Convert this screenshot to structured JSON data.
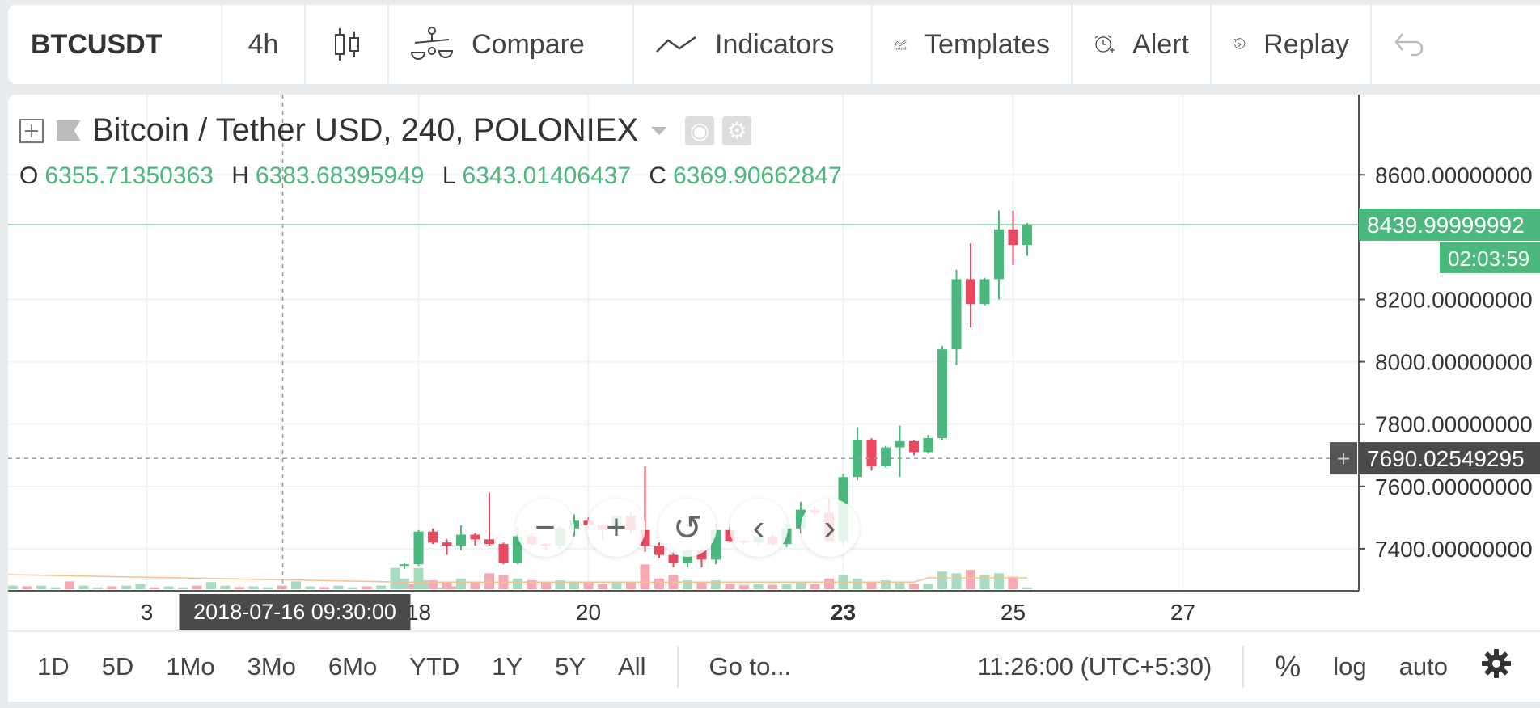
{
  "toolbar": {
    "symbol": "BTCUSDT",
    "interval": "4h",
    "compare_label": "Compare",
    "indicators_label": "Indicators",
    "templates_label": "Templates",
    "alert_label": "Alert",
    "replay_label": "Replay"
  },
  "legend": {
    "title": "Bitcoin / Tether USD, 240, POLONIEX",
    "o_label": "O",
    "o": "6355.71350363",
    "h_label": "H",
    "h": "6383.68395949",
    "l_label": "L",
    "l": "6343.01406437",
    "c_label": "C",
    "c": "6369.90662847"
  },
  "colors": {
    "up": "#4bb87d",
    "down": "#e8495e",
    "up_vol": "#a8dcc0",
    "down_vol": "#f4a9b3"
  },
  "chart_data": {
    "type": "candlestick",
    "y_ticks": [
      {
        "label": "8600.00000000",
        "value": 8600
      },
      {
        "label": "8200.00000000",
        "value": 8200
      },
      {
        "label": "8000.00000000",
        "value": 8000
      },
      {
        "label": "7800.00000000",
        "value": 7800
      },
      {
        "label": "7600.00000000",
        "value": 7600
      },
      {
        "label": "7400.00000000",
        "value": 7400
      }
    ],
    "ylim": [
      7270,
      8650
    ],
    "x_ticks": [
      {
        "label": "3",
        "index": -18.2
      },
      {
        "label": "18",
        "index": 1
      },
      {
        "label": "20",
        "index": 13
      },
      {
        "label": "23",
        "index": 31,
        "bold": true
      },
      {
        "label": "25",
        "index": 43
      },
      {
        "label": "27",
        "index": 55
      }
    ],
    "last_price": {
      "label": "8439.99999992",
      "value": 8440,
      "countdown": "02:03:59"
    },
    "crosshair": {
      "price_label": "7690.02549295",
      "value": 7690,
      "time_label": "2018-07-16 09:30:00",
      "index": -8.6
    },
    "candles": [
      [
        7345,
        7355,
        7335,
        7350,
        30
      ],
      [
        7350,
        7460,
        7345,
        7455,
        60
      ],
      [
        7455,
        7465,
        7415,
        7420,
        25
      ],
      [
        7420,
        7430,
        7380,
        7410,
        20
      ],
      [
        7410,
        7475,
        7395,
        7445,
        30
      ],
      [
        7445,
        7450,
        7410,
        7430,
        20
      ],
      [
        7430,
        7580,
        7410,
        7415,
        45
      ],
      [
        7415,
        7420,
        7350,
        7355,
        40
      ],
      [
        7355,
        7470,
        7350,
        7440,
        30
      ],
      [
        7440,
        7450,
        7410,
        7415,
        25
      ],
      [
        7415,
        7420,
        7395,
        7410,
        20
      ],
      [
        7410,
        7470,
        7400,
        7465,
        25
      ],
      [
        7465,
        7510,
        7440,
        7490,
        22
      ],
      [
        7490,
        7500,
        7460,
        7475,
        18
      ],
      [
        7475,
        7480,
        7430,
        7460,
        15
      ],
      [
        7460,
        7510,
        7450,
        7505,
        18
      ],
      [
        7505,
        7515,
        7450,
        7460,
        20
      ],
      [
        7460,
        7665,
        7390,
        7410,
        70
      ],
      [
        7410,
        7420,
        7370,
        7380,
        30
      ],
      [
        7380,
        7400,
        7340,
        7355,
        40
      ],
      [
        7355,
        7400,
        7340,
        7395,
        25
      ],
      [
        7395,
        7405,
        7340,
        7365,
        20
      ],
      [
        7365,
        7480,
        7350,
        7460,
        25
      ],
      [
        7460,
        7470,
        7420,
        7425,
        15
      ],
      [
        7425,
        7430,
        7415,
        7420,
        12
      ],
      [
        7420,
        7445,
        7410,
        7440,
        15
      ],
      [
        7440,
        7445,
        7410,
        7415,
        12
      ],
      [
        7415,
        7480,
        7405,
        7465,
        15
      ],
      [
        7465,
        7550,
        7450,
        7525,
        18
      ],
      [
        7525,
        7535,
        7510,
        7515,
        14
      ],
      [
        7515,
        7560,
        7430,
        7425,
        30
      ],
      [
        7425,
        7640,
        7410,
        7630,
        40
      ],
      [
        7630,
        7790,
        7620,
        7750,
        30
      ],
      [
        7750,
        7755,
        7650,
        7665,
        20
      ],
      [
        7665,
        7730,
        7660,
        7725,
        25
      ],
      [
        7725,
        7795,
        7630,
        7745,
        18
      ],
      [
        7745,
        7750,
        7700,
        7710,
        15
      ],
      [
        7710,
        7765,
        7705,
        7755,
        15
      ],
      [
        7755,
        8050,
        7750,
        8040,
        50
      ],
      [
        8040,
        8295,
        7990,
        8265,
        45
      ],
      [
        8265,
        8380,
        8110,
        8185,
        55
      ],
      [
        8185,
        8270,
        8180,
        8265,
        40
      ],
      [
        8265,
        8485,
        8200,
        8425,
        45
      ],
      [
        8425,
        8485,
        8310,
        8375,
        35
      ],
      [
        8375,
        8445,
        8340,
        8440,
        5
      ]
    ],
    "vol_scale": [
      0,
      320
    ],
    "pre_volumes": [
      10,
      8,
      10,
      5,
      22,
      10,
      5,
      8,
      10,
      15,
      5,
      8,
      5,
      10,
      20,
      10,
      6,
      8,
      5,
      10,
      22,
      8,
      6,
      10,
      5,
      8,
      10,
      60,
      15,
      25,
      5,
      8
    ]
  },
  "bottom": {
    "ranges": [
      "1D",
      "5D",
      "1Mo",
      "3Mo",
      "6Mo",
      "YTD",
      "1Y",
      "5Y",
      "All"
    ],
    "goto_label": "Go to...",
    "time": "11:26:00 (UTC+5:30)",
    "percent_label": "%",
    "log_label": "log",
    "auto_label": "auto"
  }
}
